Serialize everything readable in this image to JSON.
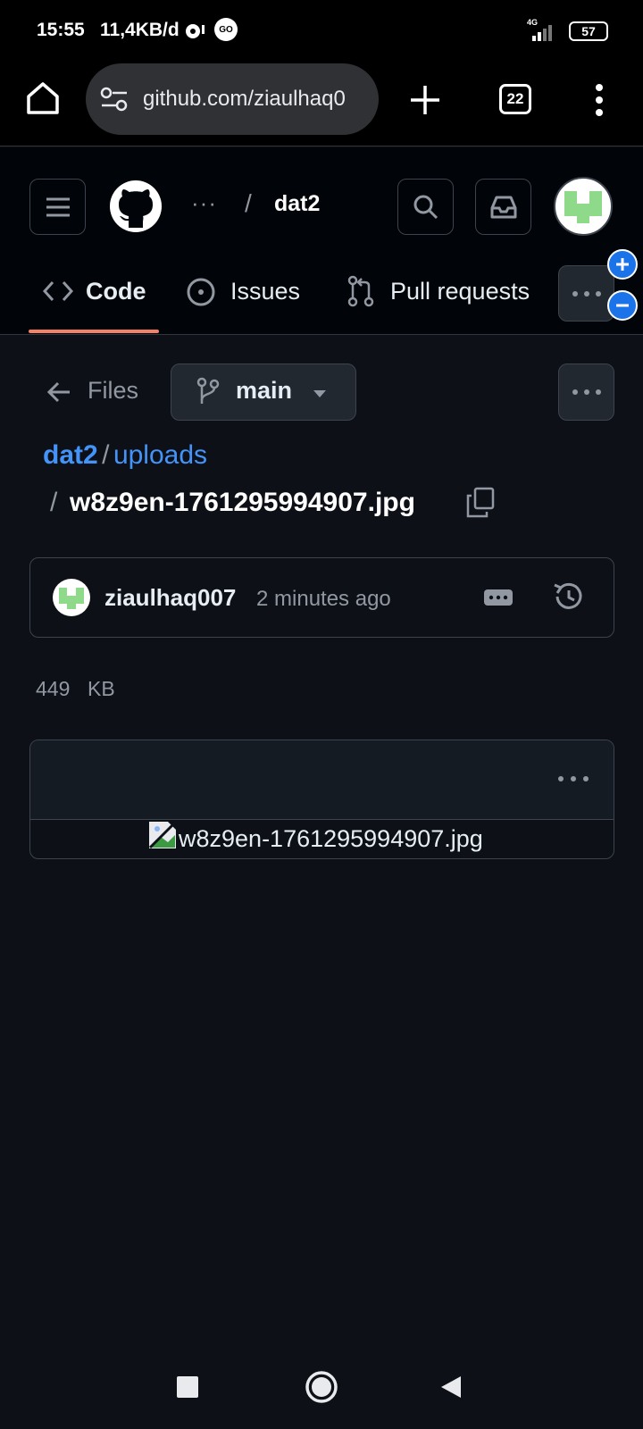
{
  "status_bar": {
    "time": "15:55",
    "network_speed": "11,4KB/d",
    "go_badge": "GO",
    "signal_label": "4G",
    "battery": "57"
  },
  "browser": {
    "url": "github.com/ziaulhaq0",
    "tab_count": "22"
  },
  "header": {
    "breadcrumb_ellipsis": "···",
    "breadcrumb_separator": "/",
    "repo": "dat2"
  },
  "repo_nav": {
    "tabs": [
      {
        "label": "Code",
        "active": true
      },
      {
        "label": "Issues",
        "active": false
      },
      {
        "label": "Pull requests",
        "active": false
      }
    ]
  },
  "file_header": {
    "files_label": "Files",
    "branch": "main"
  },
  "path": {
    "repo": "dat2",
    "separator": "/",
    "folder": "uploads",
    "file_separator": "/",
    "file": "w8z9en-1761295994907.jpg"
  },
  "commit": {
    "author": "ziaulhaq007",
    "time": "2 minutes ago"
  },
  "file_size": {
    "value": "449",
    "unit": "KB"
  },
  "viewer": {
    "image_alt": "w8z9en-1761295994907.jpg"
  },
  "colors": {
    "background": "#0d1117",
    "header": "#010409",
    "accent_link": "#4493f8",
    "active_tab_underline": "#f78166",
    "zoom_button": "#1a73e8"
  }
}
